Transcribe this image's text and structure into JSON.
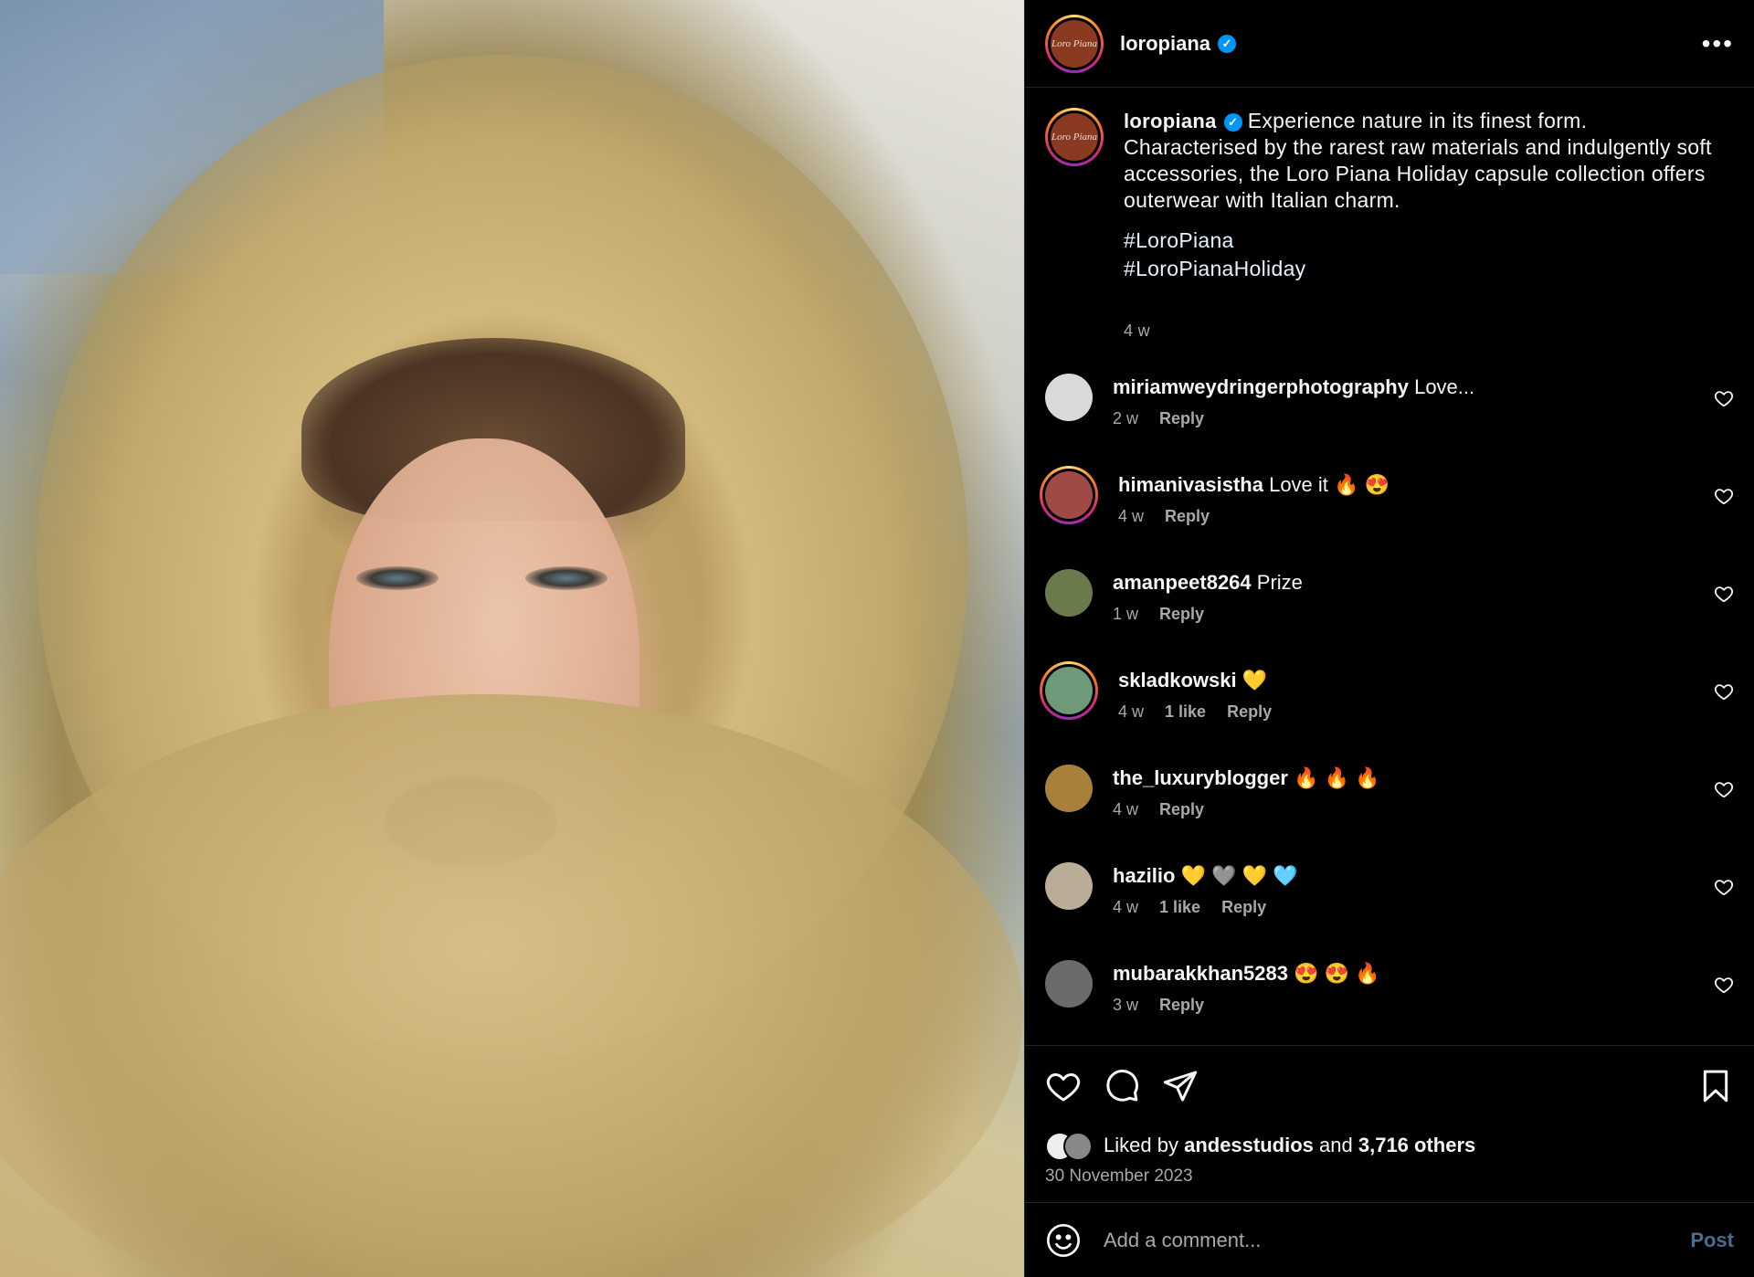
{
  "post": {
    "username": "loropiana",
    "brand_mark": "Loro Piana",
    "more_icon": "more-horizontal-icon"
  },
  "caption": {
    "username": "loropiana",
    "first_line": "Experience nature in its finest form.",
    "body": "Characterised by the rarest raw materials and indulgently soft accessories, the Loro Piana Holiday capsule collection offers outerwear with Italian charm.",
    "tags": [
      "#LoroPiana",
      "#LoroPianaHoliday"
    ],
    "time": "4 w"
  },
  "comments": [
    {
      "user": "miriamweydringerphotography",
      "text": "Love...",
      "time": "2 w",
      "likes": "",
      "reply": "Reply",
      "avatar_color": "#d9d9d9",
      "ringed": false
    },
    {
      "user": "himanivasistha",
      "text": "Love it 🔥 😍",
      "time": "4 w",
      "likes": "",
      "reply": "Reply",
      "avatar_color": "#a04a48",
      "ringed": true
    },
    {
      "user": "amanpeet8264",
      "text": "Prize",
      "time": "1 w",
      "likes": "",
      "reply": "Reply",
      "avatar_color": "#6a7a4a",
      "ringed": false
    },
    {
      "user": "skladkowski",
      "text": "💛",
      "time": "4 w",
      "likes": "1 like",
      "reply": "Reply",
      "avatar_color": "#6f9a7a",
      "ringed": true
    },
    {
      "user": "the_luxuryblogger",
      "text": "🔥 🔥 🔥",
      "time": "4 w",
      "likes": "",
      "reply": "Reply",
      "avatar_color": "#a8803a",
      "ringed": false
    },
    {
      "user": "hazilio",
      "text": "💛 🩶 💛 🩵",
      "time": "4 w",
      "likes": "1 like",
      "reply": "Reply",
      "avatar_color": "#b9ad98",
      "ringed": false
    },
    {
      "user": "mubarakkhan5283",
      "text": "😍 😍 🔥",
      "time": "3 w",
      "likes": "",
      "reply": "Reply",
      "avatar_color": "#6b6b6b",
      "ringed": false
    }
  ],
  "likes": {
    "prefix": "Liked by",
    "user": "andesstudios",
    "and": "and",
    "others": "3,716 others",
    "date": "30 November 2023"
  },
  "add_comment": {
    "placeholder": "Add a comment...",
    "post_label": "Post"
  }
}
